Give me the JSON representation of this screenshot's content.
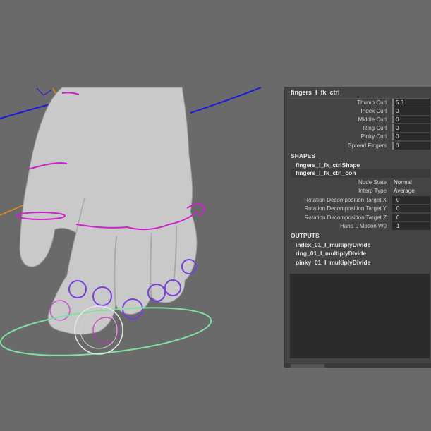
{
  "node": {
    "title": "fingers_l_fk_ctrl"
  },
  "attributes": [
    {
      "label": "Thumb Curl",
      "value": "5.3"
    },
    {
      "label": "Index Curl",
      "value": "0"
    },
    {
      "label": "Middle Curl",
      "value": "0"
    },
    {
      "label": "Ring Curl",
      "value": "0"
    },
    {
      "label": "Pinky Curl",
      "value": "0"
    },
    {
      "label": "Spread Fingers",
      "value": "0"
    }
  ],
  "shapes": {
    "heading": "SHAPES",
    "items": [
      "fingers_l_fk_ctrlShape",
      "fingers_l_fk_ctrl_con"
    ],
    "attributes": [
      {
        "label": "Node State",
        "value": "Normal"
      },
      {
        "label": "Interp Type",
        "value": "Average"
      },
      {
        "label": "Rotation Decomposition Target X",
        "value": "0"
      },
      {
        "label": "Rotation Decomposition Target Y",
        "value": "0"
      },
      {
        "label": "Rotation Decomposition Target Z",
        "value": "0"
      },
      {
        "label": "Hand L Motion W0",
        "value": "1"
      }
    ]
  },
  "outputs": {
    "heading": "OUTPUTS",
    "items": [
      "index_01_l_multiplyDivide",
      "ring_01_l_multiplyDivide",
      "pinky_01_l_multiplyDivide"
    ]
  },
  "colors": {
    "viewport_bg": "#6a6a6a",
    "panel_bg": "#444444",
    "control_magenta": "#cc22cc",
    "control_purple": "#7a3de0",
    "control_blue": "#1a1ae0",
    "control_green": "#7fe0a0",
    "control_orange": "#e08a1a"
  }
}
